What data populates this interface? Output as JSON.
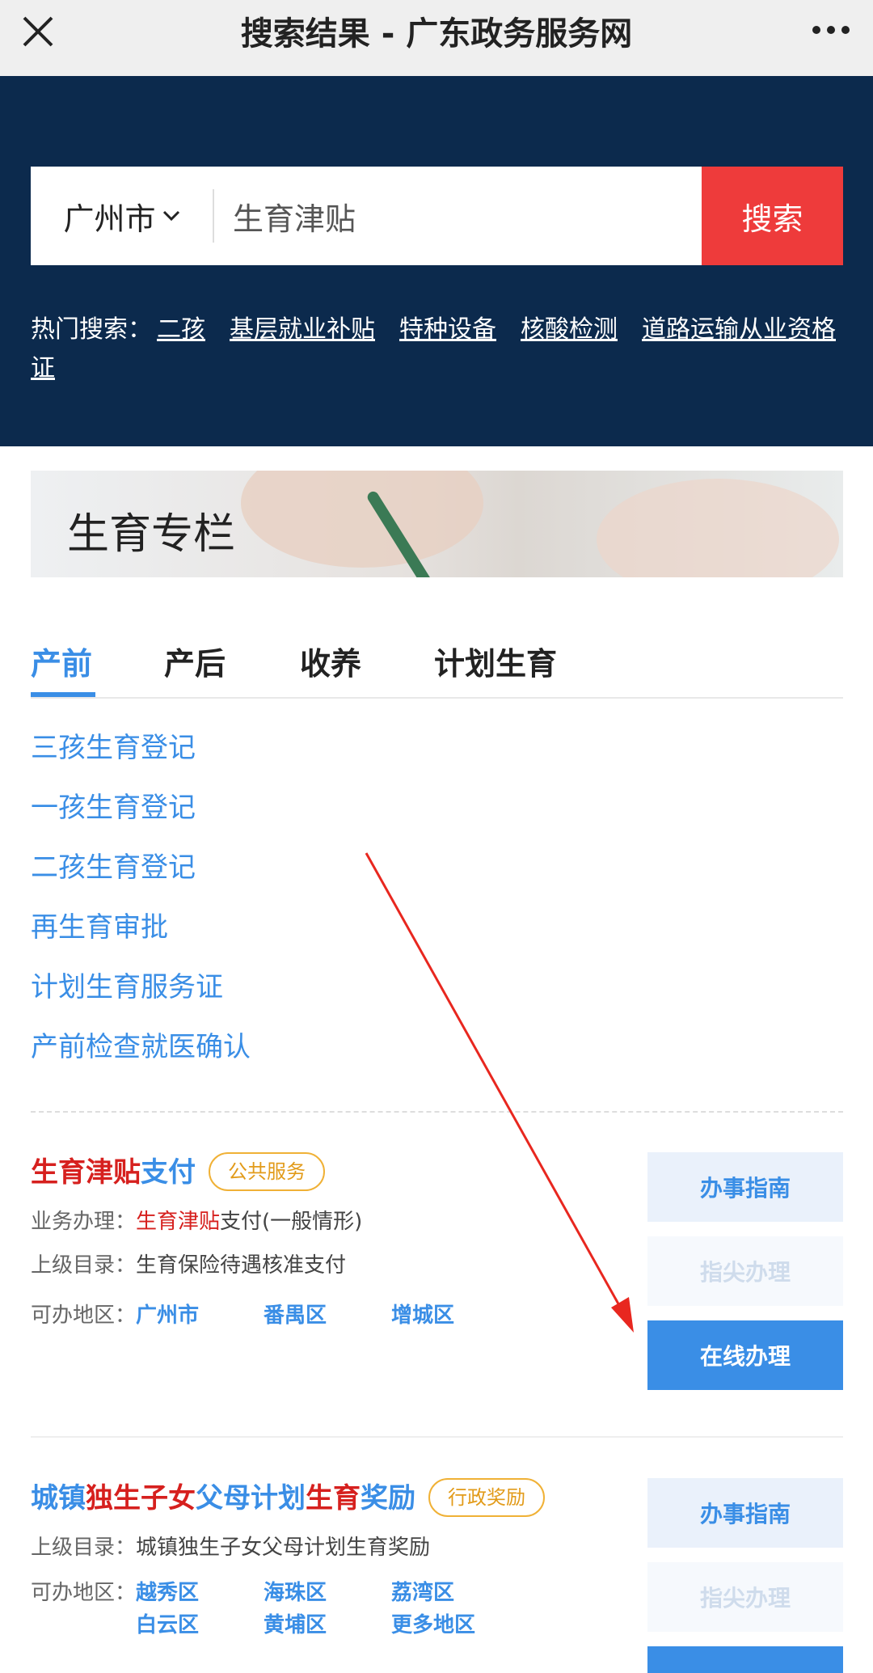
{
  "topbar": {
    "title": "搜索结果 - 广东政务服务网"
  },
  "search": {
    "city": "广州市",
    "query": "生育津贴",
    "button": "搜索"
  },
  "hot": {
    "label": "热门搜索：",
    "items": [
      "二孩",
      "基层就业补贴",
      "特种设备",
      "核酸检测",
      "道路运输从业资格证"
    ]
  },
  "banner": {
    "title": "生育专栏"
  },
  "tabs": [
    "产前",
    "产后",
    "收养",
    "计划生育"
  ],
  "links": [
    "三孩生育登记",
    "一孩生育登记",
    "二孩生育登记",
    "再生育审批",
    "计划生育服务证",
    "产前检查就医确认"
  ],
  "card1": {
    "title_hl": "生育津贴",
    "title_rest": "支付",
    "badge": "公共服务",
    "biz_label": "业务办理：",
    "biz_hl": "生育津贴",
    "biz_rest": "支付(一般情形)",
    "parent_label": "上级目录：",
    "parent": "生育保险待遇核准支付",
    "area_label": "可办地区：",
    "areas": [
      "广州市",
      "番禺区",
      "增城区"
    ],
    "btn_guide": "办事指南",
    "btn_finger": "指尖办理",
    "btn_online": "在线办理"
  },
  "card2": {
    "t1": "城镇",
    "t2": "独生子女",
    "t3": "父母计划",
    "t4": "生育",
    "t5": "奖励",
    "badge": "行政奖励",
    "parent_label": "上级目录：",
    "parent": "城镇独生子女父母计划生育奖励",
    "area_label": "可办地区：",
    "areas_row1": [
      "越秀区",
      "海珠区",
      "荔湾区"
    ],
    "areas_row2": [
      "白云区",
      "黄埔区",
      "更多地区"
    ],
    "btn_guide": "办事指南",
    "btn_finger": "指尖办理"
  },
  "colors": {
    "navy": "#0c2a4d",
    "red": "#ee3b3b",
    "blue": "#3a8ee6",
    "badge": "#f0b136"
  }
}
